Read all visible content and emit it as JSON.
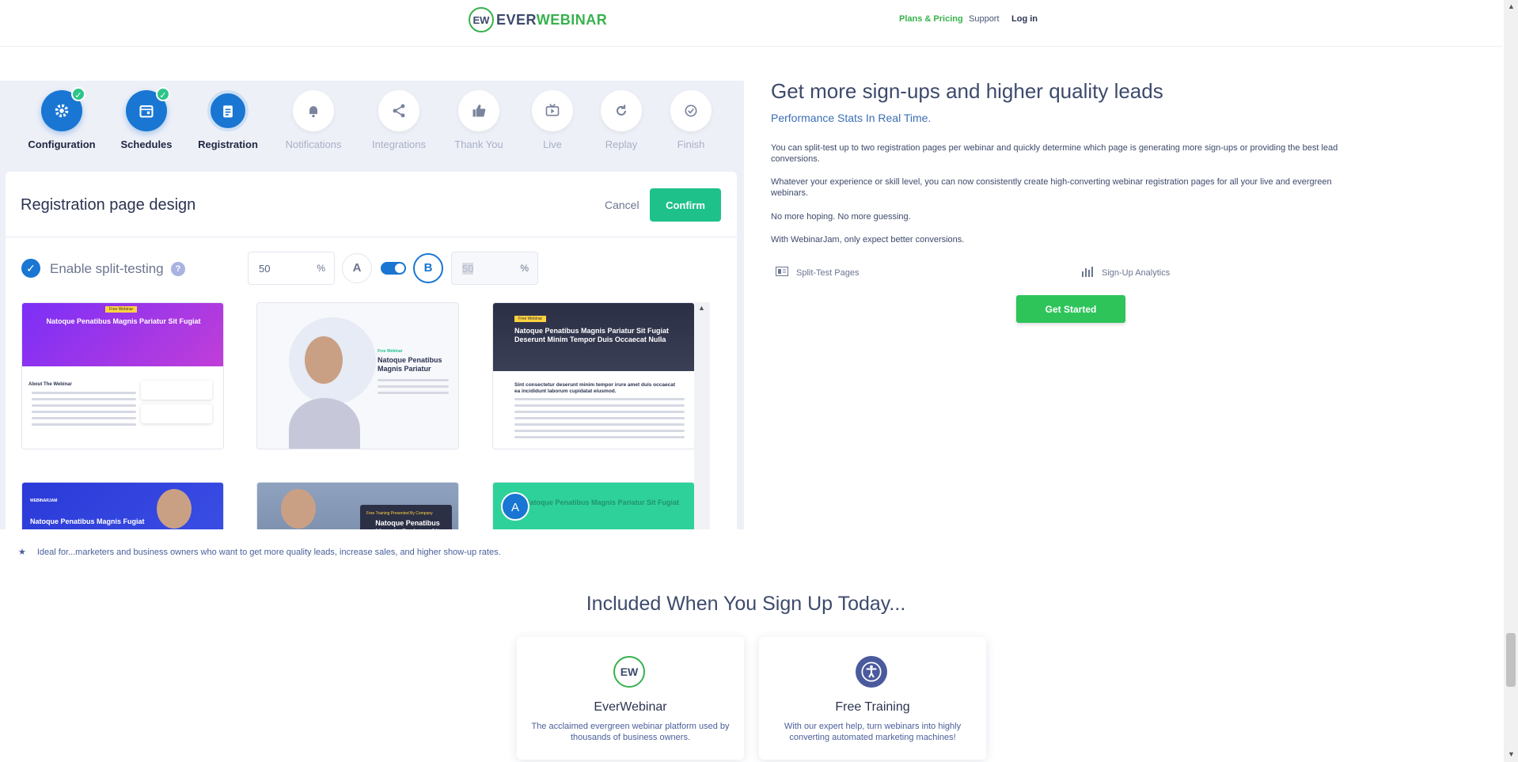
{
  "header": {
    "logo_mark": "EW",
    "logo_text_ever": "EVER",
    "logo_text_webinar": "WEBINAR",
    "nav": {
      "pricing": "Plans & Pricing",
      "support": "Support",
      "login": "Log in"
    }
  },
  "app": {
    "steps": [
      {
        "label": "Configuration",
        "icon": "gear-icon",
        "state": "done"
      },
      {
        "label": "Schedules",
        "icon": "calendar-icon",
        "state": "done"
      },
      {
        "label": "Registration",
        "icon": "clipboard-icon",
        "state": "active"
      },
      {
        "label": "Notifications",
        "icon": "bell-icon",
        "state": "todo"
      },
      {
        "label": "Integrations",
        "icon": "share-icon",
        "state": "todo"
      },
      {
        "label": "Thank You",
        "icon": "thumbs-up-icon",
        "state": "todo"
      },
      {
        "label": "Live",
        "icon": "live-tv-icon",
        "state": "todo"
      },
      {
        "label": "Replay",
        "icon": "replay-icon",
        "state": "todo"
      },
      {
        "label": "Finish",
        "icon": "check-circle-icon",
        "state": "todo"
      }
    ],
    "card": {
      "title": "Registration page design",
      "cancel": "Cancel",
      "confirm": "Confirm",
      "split_label": "Enable split-testing",
      "split_help": "?",
      "split_a_value": "50",
      "split_b_value": "50",
      "percent": "%",
      "variant_a": "A",
      "variant_b": "B",
      "toggle_on": true
    },
    "templates": [
      {
        "heading": "Natoque Penatibus Magnis Pariatur Sit Fugiat",
        "tag": "Free Webinar",
        "section": "About The Webinar"
      },
      {
        "heading": "Natoque Penatibus Magnis Pariatur",
        "tag": "Free Webinar"
      },
      {
        "heading": "Natoque Penatibus Magnis Pariatur Sit Fugiat Deserunt Minim Tempor Duis Occaecat Nulla",
        "tag": "Free Webinar",
        "section": "Sint consectetur deserunt minim tempor irure amet duis occaecat ea incididunt laborum cupidatat eiusmod."
      },
      {
        "heading": "Natoque Penatibus Magnis Fugiat",
        "brand": "WEBINARJAM"
      },
      {
        "heading": "Natoque Penatibus Magnis Pariatur Sit Fugiat",
        "tag": "Free Training Presented By Company"
      },
      {
        "heading": "Natoque Penatibus Magnis Pariatur Sit Fugiat",
        "badge": "A"
      }
    ]
  },
  "copy": {
    "title": "Get more sign-ups and higher quality leads",
    "subtitle": "Performance Stats In Real Time.",
    "paragraphs": [
      "You can split-test up to two registration pages per webinar and quickly determine which page is generating more sign-ups or providing the best lead conversions.",
      "Whatever your experience or skill level, you can now consistently create high-converting webinar registration pages for all your live and evergreen webinars.",
      "No more hoping. No more guessing.",
      "With WebinarJam, only expect better conversions."
    ],
    "features": [
      {
        "label": "Split-Test Pages",
        "icon": "split-test-icon"
      },
      {
        "label": "Sign-Up Analytics",
        "icon": "bar-chart-icon"
      }
    ],
    "cta": "Get Started"
  },
  "ideal": "Ideal for...marketers and business owners who want to get more quality leads, increase sales, and higher show-up rates.",
  "included": {
    "title": "Included When You Sign Up Today...",
    "cards": [
      {
        "name": "EverWebinar",
        "desc": "The acclaimed evergreen webinar platform used by thousands of business owners.",
        "icon": "everwebinar-logo-icon"
      },
      {
        "name": "Free Training",
        "desc": "With our expert help, turn webinars into highly converting automated marketing machines!",
        "icon": "accessibility-icon"
      }
    ]
  },
  "colors": {
    "brand_green": "#37b24d",
    "primary_blue": "#1976d2",
    "confirm_green": "#1ec18a",
    "cta_green": "#2ec45a"
  }
}
